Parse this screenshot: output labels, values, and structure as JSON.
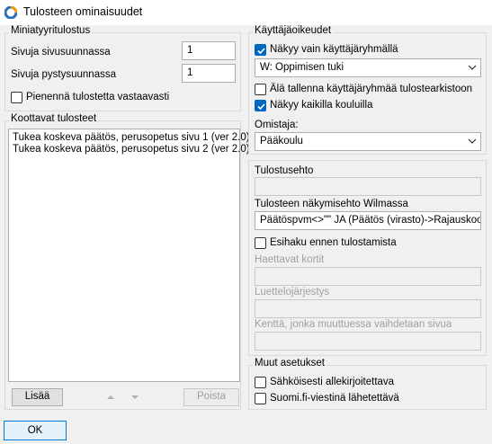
{
  "window": {
    "title": "Tulosteen ominaisuudet"
  },
  "thumbnail": {
    "title": "Miniatyyritulostus",
    "pages_horizontal_label": "Sivuja sivusuunnassa",
    "pages_horizontal_value": "1",
    "pages_vertical_label": "Sivuja pystysuunnassa",
    "pages_vertical_value": "1",
    "shrink_label": "Pienennä tulostetta vastaavasti",
    "shrink_checked": false
  },
  "compiled": {
    "title": "Koottavat tulosteet",
    "items": [
      "Tukea koskeva päätös, perusopetus sivu 1 (ver 2.0)",
      "Tukea koskeva päätös, perusopetus sivu 2 (ver 2.0)"
    ],
    "add_label": "Lisää",
    "remove_label": "Poista"
  },
  "rights": {
    "title": "Käyttäjäoikeudet",
    "group_only_label": "Näkyy vain käyttäjäryhmällä",
    "group_only_checked": true,
    "group_value": "W: Oppimisen tuki",
    "dont_save_label": "Älä tallenna käyttäjäryhmää tulostearkistoon",
    "dont_save_checked": false,
    "all_schools_label": "Näkyy kaikilla kouluilla",
    "all_schools_checked": true,
    "owner_label": "Omistaja:",
    "owner_value": "Pääkoulu"
  },
  "conditions": {
    "print_condition_label": "Tulostusehto",
    "print_condition_value": "",
    "visibility_label": "Tulosteen näkymisehto Wilmassa",
    "visibility_value": "Päätöspvm<>\"\" JA (Päätös (virasto)->Rajauskoodi",
    "prefetch_label": "Esihaku ennen tulostamista",
    "prefetch_checked": false,
    "cards_label": "Haettavat kortit",
    "lists_label": "Luettelojärjestys",
    "field_label": "Kenttä, jonka muuttuessa vaihdetaan sivua"
  },
  "other": {
    "title": "Muut asetukset",
    "signed_label": "Sähköisesti allekirjoitettava",
    "signed_checked": false,
    "suomifi_label": "Suomi.fi-viestinä lähetettävä",
    "suomifi_checked": false
  },
  "ok_label": "OK",
  "colors": {
    "accent": "#0067c0",
    "ok_border": "#0078d7",
    "background": "#f0f0f0"
  }
}
